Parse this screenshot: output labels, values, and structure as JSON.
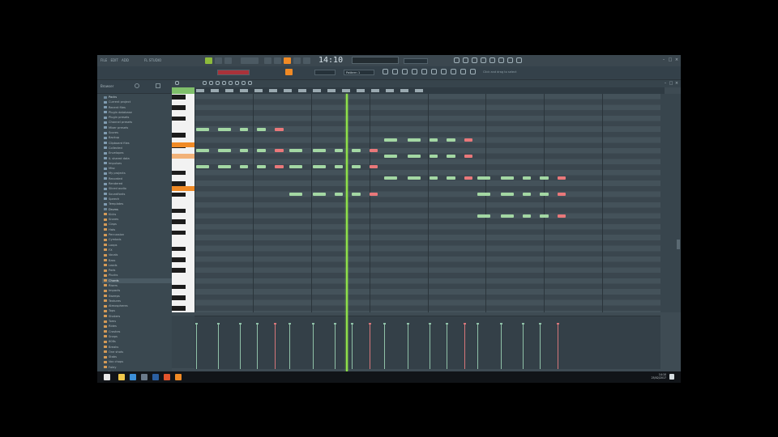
{
  "app": {
    "title": "FL STUDIO",
    "time_display": "14:10",
    "pattern_label": "Pattern 1",
    "hint_text": "Click and drag to select",
    "window_controls": [
      "–",
      "□",
      "×"
    ]
  },
  "browser": {
    "header": "Browser",
    "items": [
      {
        "label": "Packs",
        "kind": "folder"
      },
      {
        "label": "Current project",
        "kind": "pack"
      },
      {
        "label": "Recent files",
        "kind": "pack"
      },
      {
        "label": "Plugin database",
        "kind": "pack"
      },
      {
        "label": "Plugin presets",
        "kind": "pack"
      },
      {
        "label": "Channel presets",
        "kind": "pack"
      },
      {
        "label": "Mixer presets",
        "kind": "pack"
      },
      {
        "label": "Scores",
        "kind": "pack"
      },
      {
        "label": "Backup",
        "kind": "pack"
      },
      {
        "label": "Clipboard files",
        "kind": "pack"
      },
      {
        "label": "Collected",
        "kind": "pack"
      },
      {
        "label": "Envelopes",
        "kind": "pack"
      },
      {
        "label": "IL shared data",
        "kind": "pack"
      },
      {
        "label": "Impulses",
        "kind": "pack"
      },
      {
        "label": "Misc",
        "kind": "pack"
      },
      {
        "label": "My projects",
        "kind": "pack"
      },
      {
        "label": "Recorded",
        "kind": "pack"
      },
      {
        "label": "Rendered",
        "kind": "pack"
      },
      {
        "label": "Sliced audio",
        "kind": "pack"
      },
      {
        "label": "Soundfonts",
        "kind": "pack"
      },
      {
        "label": "Speech",
        "kind": "pack"
      },
      {
        "label": "Templates",
        "kind": "pack"
      },
      {
        "label": "Drums",
        "kind": "folder"
      },
      {
        "label": "Kicks",
        "kind": "sample"
      },
      {
        "label": "Snares",
        "kind": "sample"
      },
      {
        "label": "Claps",
        "kind": "sample"
      },
      {
        "label": "Hats",
        "kind": "sample"
      },
      {
        "label": "Percussion",
        "kind": "sample"
      },
      {
        "label": "Cymbals",
        "kind": "sample"
      },
      {
        "label": "Loops",
        "kind": "sample"
      },
      {
        "label": "FX",
        "kind": "sample"
      },
      {
        "label": "Vocals",
        "kind": "sample"
      },
      {
        "label": "Bass",
        "kind": "sample"
      },
      {
        "label": "Leads",
        "kind": "sample"
      },
      {
        "label": "Pads",
        "kind": "sample"
      },
      {
        "label": "Plucks",
        "kind": "sample"
      },
      {
        "label": "Chords",
        "kind": "sample"
      },
      {
        "label": "Risers",
        "kind": "sample"
      },
      {
        "label": "Impacts",
        "kind": "sample"
      },
      {
        "label": "Sweeps",
        "kind": "sample"
      },
      {
        "label": "Textures",
        "kind": "sample"
      },
      {
        "label": "Atmospheres",
        "kind": "sample"
      },
      {
        "label": "Tops",
        "kind": "sample"
      },
      {
        "label": "Shakers",
        "kind": "sample"
      },
      {
        "label": "Toms",
        "kind": "sample"
      },
      {
        "label": "Rides",
        "kind": "sample"
      },
      {
        "label": "Crashes",
        "kind": "sample"
      },
      {
        "label": "Snaps",
        "kind": "sample"
      },
      {
        "label": "808s",
        "kind": "sample"
      },
      {
        "label": "Breaks",
        "kind": "sample"
      },
      {
        "label": "One shots",
        "kind": "sample"
      },
      {
        "label": "Stabs",
        "kind": "sample"
      },
      {
        "label": "Vox chops",
        "kind": "sample"
      },
      {
        "label": "Foley",
        "kind": "sample"
      },
      {
        "label": "Noise",
        "kind": "sample"
      },
      {
        "label": "Reverse",
        "kind": "sample"
      },
      {
        "label": "Transitions",
        "kind": "sample"
      }
    ],
    "selected_index": 36
  },
  "piano_roll": {
    "bars": 8,
    "rows": 40,
    "playhead_beat": 10.4,
    "total_beats": 32,
    "highlighted_keys": [
      {
        "row": 9,
        "tone": "orange"
      },
      {
        "row": 11,
        "tone": "light"
      },
      {
        "row": 17,
        "tone": "orange"
      }
    ],
    "notes": [
      {
        "row": 6,
        "start": 0.0,
        "len": 1.0,
        "color": "green"
      },
      {
        "row": 6,
        "start": 1.5,
        "len": 1.0,
        "color": "green"
      },
      {
        "row": 6,
        "start": 3.0,
        "len": 0.7,
        "color": "green"
      },
      {
        "row": 6,
        "start": 4.2,
        "len": 0.7,
        "color": "green"
      },
      {
        "row": 6,
        "start": 5.4,
        "len": 0.7,
        "color": "red"
      },
      {
        "row": 10,
        "start": 0.0,
        "len": 1.0,
        "color": "green"
      },
      {
        "row": 10,
        "start": 1.5,
        "len": 1.0,
        "color": "green"
      },
      {
        "row": 10,
        "start": 3.0,
        "len": 0.7,
        "color": "green"
      },
      {
        "row": 10,
        "start": 4.2,
        "len": 0.7,
        "color": "green"
      },
      {
        "row": 10,
        "start": 5.4,
        "len": 0.7,
        "color": "red"
      },
      {
        "row": 13,
        "start": 0.0,
        "len": 1.0,
        "color": "green"
      },
      {
        "row": 13,
        "start": 1.5,
        "len": 1.0,
        "color": "green"
      },
      {
        "row": 13,
        "start": 3.0,
        "len": 0.7,
        "color": "green"
      },
      {
        "row": 13,
        "start": 4.2,
        "len": 0.7,
        "color": "green"
      },
      {
        "row": 13,
        "start": 5.4,
        "len": 0.7,
        "color": "red"
      },
      {
        "row": 10,
        "start": 6.4,
        "len": 1.0,
        "color": "green"
      },
      {
        "row": 10,
        "start": 8.0,
        "len": 1.0,
        "color": "green"
      },
      {
        "row": 10,
        "start": 9.5,
        "len": 0.7,
        "color": "green"
      },
      {
        "row": 10,
        "start": 10.7,
        "len": 0.7,
        "color": "green"
      },
      {
        "row": 10,
        "start": 11.9,
        "len": 0.7,
        "color": "red"
      },
      {
        "row": 13,
        "start": 6.4,
        "len": 1.0,
        "color": "green"
      },
      {
        "row": 13,
        "start": 8.0,
        "len": 1.0,
        "color": "green"
      },
      {
        "row": 13,
        "start": 9.5,
        "len": 0.7,
        "color": "green"
      },
      {
        "row": 13,
        "start": 10.7,
        "len": 0.7,
        "color": "green"
      },
      {
        "row": 13,
        "start": 11.9,
        "len": 0.7,
        "color": "red"
      },
      {
        "row": 18,
        "start": 6.4,
        "len": 1.0,
        "color": "green"
      },
      {
        "row": 18,
        "start": 8.0,
        "len": 1.0,
        "color": "green"
      },
      {
        "row": 18,
        "start": 9.5,
        "len": 0.7,
        "color": "green"
      },
      {
        "row": 18,
        "start": 10.7,
        "len": 0.7,
        "color": "green"
      },
      {
        "row": 18,
        "start": 11.9,
        "len": 0.7,
        "color": "red"
      },
      {
        "row": 8,
        "start": 12.9,
        "len": 1.0,
        "color": "green"
      },
      {
        "row": 8,
        "start": 14.5,
        "len": 1.0,
        "color": "green"
      },
      {
        "row": 8,
        "start": 16.0,
        "len": 0.7,
        "color": "green"
      },
      {
        "row": 8,
        "start": 17.2,
        "len": 0.7,
        "color": "green"
      },
      {
        "row": 8,
        "start": 18.4,
        "len": 0.7,
        "color": "red"
      },
      {
        "row": 11,
        "start": 12.9,
        "len": 1.0,
        "color": "green"
      },
      {
        "row": 11,
        "start": 14.5,
        "len": 1.0,
        "color": "green"
      },
      {
        "row": 11,
        "start": 16.0,
        "len": 0.7,
        "color": "green"
      },
      {
        "row": 11,
        "start": 17.2,
        "len": 0.7,
        "color": "green"
      },
      {
        "row": 11,
        "start": 18.4,
        "len": 0.7,
        "color": "red"
      },
      {
        "row": 15,
        "start": 12.9,
        "len": 1.0,
        "color": "green"
      },
      {
        "row": 15,
        "start": 14.5,
        "len": 1.0,
        "color": "green"
      },
      {
        "row": 15,
        "start": 16.0,
        "len": 0.7,
        "color": "green"
      },
      {
        "row": 15,
        "start": 17.2,
        "len": 0.7,
        "color": "green"
      },
      {
        "row": 15,
        "start": 18.4,
        "len": 0.7,
        "color": "red"
      },
      {
        "row": 15,
        "start": 19.3,
        "len": 1.0,
        "color": "green"
      },
      {
        "row": 15,
        "start": 20.9,
        "len": 1.0,
        "color": "green"
      },
      {
        "row": 15,
        "start": 22.4,
        "len": 0.7,
        "color": "green"
      },
      {
        "row": 15,
        "start": 23.6,
        "len": 0.7,
        "color": "green"
      },
      {
        "row": 15,
        "start": 24.8,
        "len": 0.7,
        "color": "red"
      },
      {
        "row": 18,
        "start": 19.3,
        "len": 1.0,
        "color": "green"
      },
      {
        "row": 18,
        "start": 20.9,
        "len": 1.0,
        "color": "green"
      },
      {
        "row": 18,
        "start": 22.4,
        "len": 0.7,
        "color": "green"
      },
      {
        "row": 18,
        "start": 23.6,
        "len": 0.7,
        "color": "green"
      },
      {
        "row": 18,
        "start": 24.8,
        "len": 0.7,
        "color": "red"
      },
      {
        "row": 22,
        "start": 19.3,
        "len": 1.0,
        "color": "green"
      },
      {
        "row": 22,
        "start": 20.9,
        "len": 1.0,
        "color": "green"
      },
      {
        "row": 22,
        "start": 22.4,
        "len": 0.7,
        "color": "green"
      },
      {
        "row": 22,
        "start": 23.6,
        "len": 0.7,
        "color": "green"
      },
      {
        "row": 22,
        "start": 24.8,
        "len": 0.7,
        "color": "red"
      }
    ]
  },
  "taskbar": {
    "time": "14:10",
    "date": "25/02/2017",
    "apps": [
      {
        "name": "explorer-icon",
        "color": "#f1c84b"
      },
      {
        "name": "edge-icon",
        "color": "#3c8fd8"
      },
      {
        "name": "store-icon",
        "color": "#6a7a8a"
      },
      {
        "name": "media-icon",
        "color": "#2b5fa0"
      },
      {
        "name": "chrome-icon",
        "color": "#e2542d"
      },
      {
        "name": "fl-studio-icon",
        "color": "#f08a25"
      }
    ]
  },
  "colors": {
    "accent": "#f08a25",
    "playhead": "#8ee04a",
    "note_green": "#a3d7a3",
    "note_red": "#e9787a"
  }
}
